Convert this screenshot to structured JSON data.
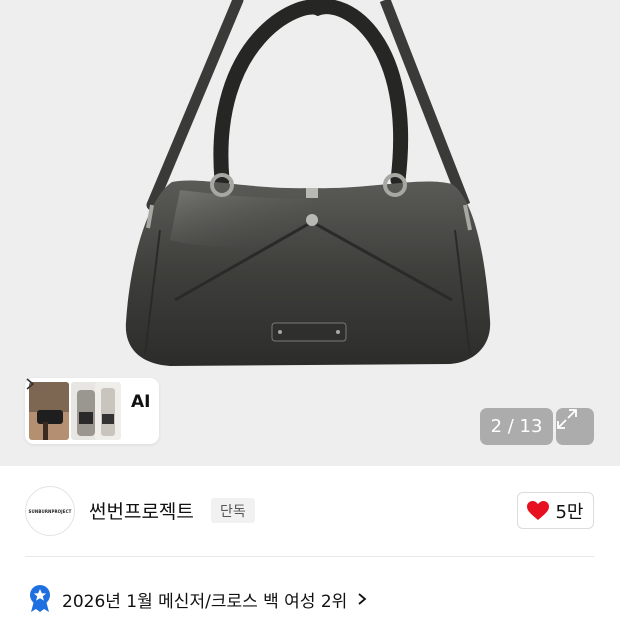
{
  "gallery": {
    "current_page": "2",
    "total_pages": "13",
    "counter_text": "2 / 13",
    "ai_label": "AI"
  },
  "brand": {
    "name": "썬번프로젝트",
    "logo_text": "SUNBURNPROJECT",
    "badge": "단독"
  },
  "likes": {
    "count": "5만",
    "icon": "heart-icon",
    "color": "#e8101f"
  },
  "ranking": {
    "text": "2026년 1월 메신저/크로스 백 여성 2위",
    "icon": "ranking-medal-icon",
    "icon_color": "#1e6fe0"
  }
}
